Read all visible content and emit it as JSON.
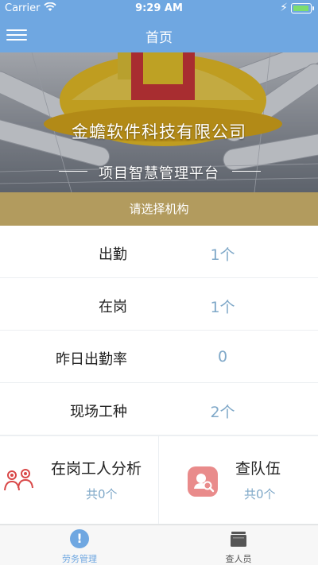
{
  "status_bar": {
    "carrier": "Carrier",
    "time": "9:29 AM",
    "battery_level": 0.85
  },
  "nav": {
    "title": "首页",
    "menu_icon": "hamburger-menu-icon"
  },
  "banner": {
    "company": "金蟾软件科技有限公司",
    "platform": "项目智慧管理平台"
  },
  "org_selector": {
    "label": "请选择机构"
  },
  "stats": [
    {
      "label": "出勤",
      "value": "1个"
    },
    {
      "label": "在岗",
      "value": "1个"
    },
    {
      "label": "昨日出勤率",
      "value": "0"
    },
    {
      "label": "现场工种",
      "value": "2个"
    }
  ],
  "cards": [
    {
      "title": "在岗工人分析",
      "count": "共0个",
      "icon": "workers-group-icon"
    },
    {
      "title": "查队伍",
      "count": "共0个",
      "icon": "search-team-icon"
    }
  ],
  "tabs": [
    {
      "label": "劳务管理",
      "icon": "alert-circle-icon",
      "active": true
    },
    {
      "label": "查人员",
      "icon": "folder-icon",
      "active": false
    }
  ],
  "colors": {
    "primary": "#6fa7e1",
    "org_bar": "#b29b5e",
    "value_text": "#7fa8c8",
    "card_icon_bg": "#e98b8b"
  }
}
